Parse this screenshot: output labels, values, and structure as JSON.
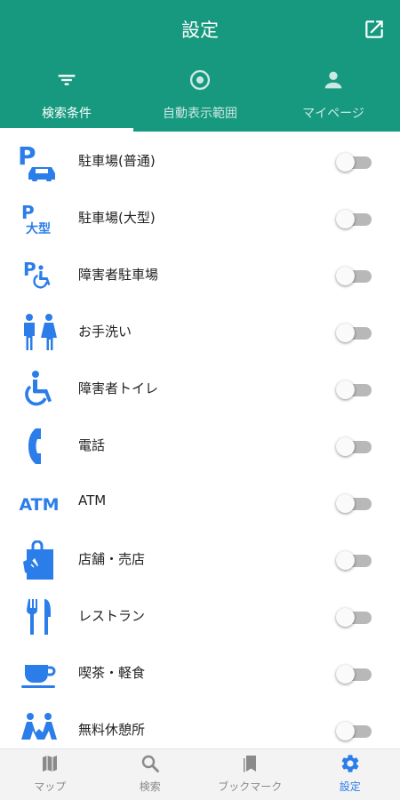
{
  "header": {
    "title": "設定",
    "external_icon": "open-in-new-icon"
  },
  "tabs": [
    {
      "label": "検索条件",
      "icon": "filter-icon",
      "active": true
    },
    {
      "label": "自動表示範囲",
      "icon": "target-icon",
      "active": false
    },
    {
      "label": "マイページ",
      "icon": "person-icon",
      "active": false
    }
  ],
  "facilities": [
    {
      "label": "駐車場(普通)",
      "icon": "parking-car-icon",
      "enabled": false
    },
    {
      "label": "駐車場(大型)",
      "icon": "parking-large-icon",
      "icon_text": "大型",
      "enabled": false
    },
    {
      "label": "障害者駐車場",
      "icon": "parking-accessible-icon",
      "enabled": false
    },
    {
      "label": "お手洗い",
      "icon": "restroom-icon",
      "enabled": false
    },
    {
      "label": "障害者トイレ",
      "icon": "accessible-toilet-icon",
      "enabled": false
    },
    {
      "label": "電話",
      "icon": "phone-icon",
      "enabled": false
    },
    {
      "label": "ATM",
      "icon": "atm-icon",
      "icon_text": "ATM",
      "enabled": false
    },
    {
      "label": "店舗・売店",
      "icon": "shopping-bag-icon",
      "enabled": false
    },
    {
      "label": "レストラン",
      "icon": "restaurant-icon",
      "enabled": false
    },
    {
      "label": "喫茶・軽食",
      "icon": "coffee-icon",
      "enabled": false
    },
    {
      "label": "無料休憩所",
      "icon": "rest-area-icon",
      "enabled": false
    }
  ],
  "bottom_nav": [
    {
      "label": "マップ",
      "icon": "map-icon",
      "active": false
    },
    {
      "label": "検索",
      "icon": "search-icon",
      "active": false
    },
    {
      "label": "ブックマーク",
      "icon": "bookmark-icon",
      "active": false
    },
    {
      "label": "設定",
      "icon": "gear-icon",
      "active": true
    }
  ],
  "colors": {
    "header": "#16997f",
    "accent": "#2b7de9",
    "toggle_off": "#b8b8b8"
  }
}
